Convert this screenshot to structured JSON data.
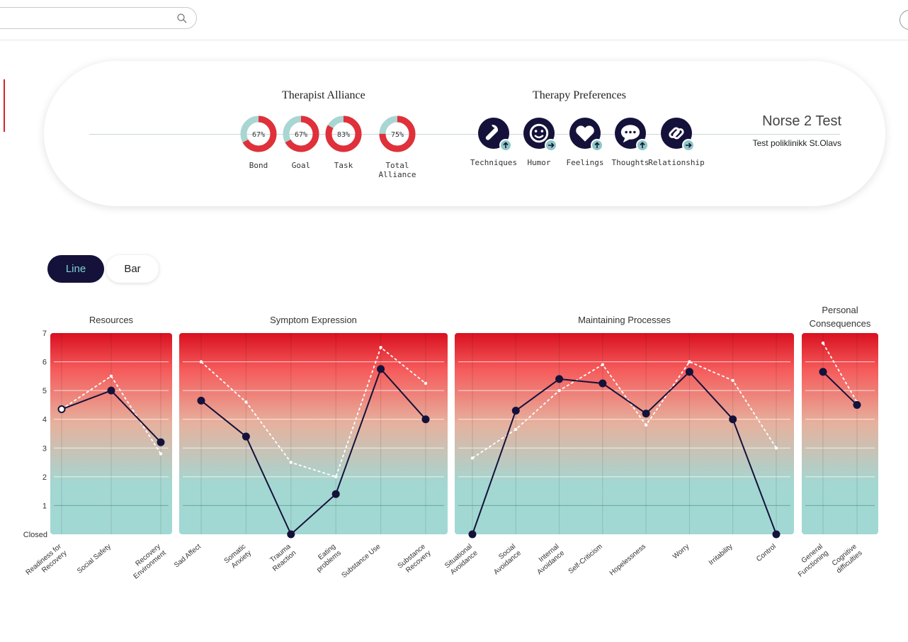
{
  "search": {
    "placeholder": "",
    "icon": "search-icon"
  },
  "alliance": {
    "title": "Therapist Alliance",
    "items": [
      {
        "label": "Bond",
        "value": 67,
        "text": "67%"
      },
      {
        "label": "Goal",
        "value": 67,
        "text": "67%"
      },
      {
        "label": "Task",
        "value": 83,
        "text": "83%"
      },
      {
        "label": "Total Alliance",
        "value": 75,
        "text": "75%"
      }
    ]
  },
  "preferences": {
    "title": "Therapy Preferences",
    "items": [
      {
        "label": "Techniques",
        "icon": "wrench-icon",
        "badge": "arrow-up-icon"
      },
      {
        "label": "Humor",
        "icon": "smiley-icon",
        "badge": "arrow-right-icon"
      },
      {
        "label": "Feelings",
        "icon": "heart-icon",
        "badge": "arrow-up-icon"
      },
      {
        "label": "Thoughts",
        "icon": "speech-bubble-icon",
        "badge": "arrow-up-icon"
      },
      {
        "label": "Relationship",
        "icon": "link-icon",
        "badge": "arrow-right-icon"
      }
    ]
  },
  "patient": {
    "name": "Norse 2 Test",
    "clinic": "Test poliklinikk St.Olavs"
  },
  "toggle": {
    "line_label": "Line",
    "bar_label": "Bar",
    "active": "Line"
  },
  "colors": {
    "accent": "#14123a",
    "teal": "#8fc7c6",
    "red": "#d9202c"
  },
  "chart_data": {
    "type": "line",
    "ylim": [
      0,
      7
    ],
    "yticks": [
      "Closed",
      "1",
      "2",
      "3",
      "4",
      "5",
      "6",
      "7"
    ],
    "series": [
      {
        "style": "solid-dark"
      },
      {
        "style": "dashed-white"
      }
    ],
    "panels": [
      {
        "title": "Resources",
        "categories": [
          "Readiness for Recovery",
          "Social Safety",
          "Recovery Environment"
        ],
        "series_values": [
          [
            4.35,
            5.0,
            3.2
          ],
          [
            4.35,
            5.5,
            2.8
          ]
        ]
      },
      {
        "title": "Symptom Expression",
        "categories": [
          "Sad Affect",
          "Somatic Anxiety",
          "Trauma Reaction",
          "Eating problems",
          "Substance Use",
          "Substance Recovery"
        ],
        "series_values": [
          [
            4.65,
            3.4,
            0,
            1.4,
            5.75,
            4.0
          ],
          [
            6.0,
            4.6,
            2.5,
            2.0,
            6.5,
            5.25
          ]
        ]
      },
      {
        "title": "Maintaining Processes",
        "categories": [
          "Situational Avoidance",
          "Social Avoidance",
          "Internal Avoidance",
          "Self-Criticism",
          "Hopelessness",
          "Worry",
          "Irritability",
          "Control"
        ],
        "series_values": [
          [
            0,
            4.3,
            5.4,
            5.25,
            4.2,
            5.65,
            4.0,
            0
          ],
          [
            2.65,
            3.65,
            5.0,
            5.9,
            3.8,
            6.0,
            5.35,
            3.0
          ]
        ]
      },
      {
        "title": "Personal Consequences",
        "categories": [
          "General Functioning",
          "Cognitive difficulties"
        ],
        "series_values": [
          [
            5.65,
            4.5
          ],
          [
            6.65,
            4.6
          ]
        ]
      }
    ]
  }
}
